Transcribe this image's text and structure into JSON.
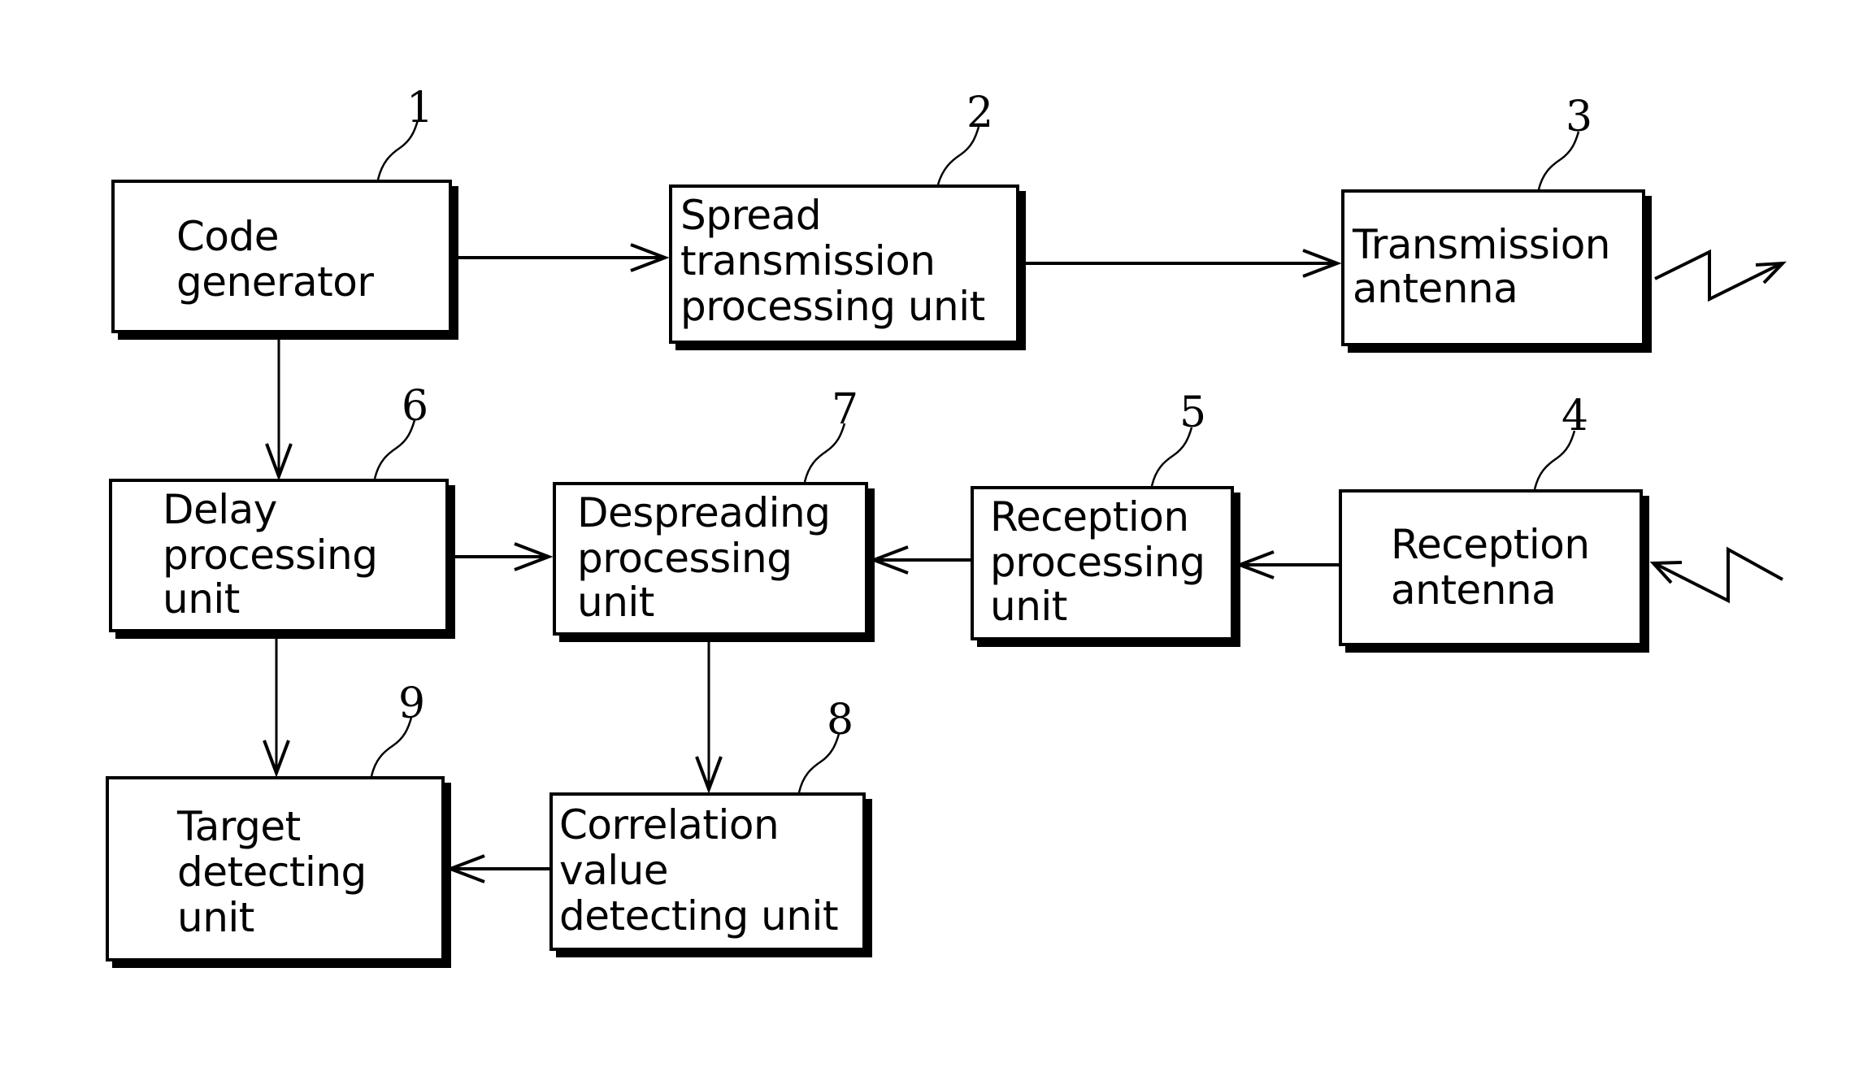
{
  "diagram": {
    "type": "block-diagram",
    "blocks": [
      {
        "id": "1",
        "ref": "1",
        "lines": [
          "Code",
          "generator"
        ]
      },
      {
        "id": "2",
        "ref": "2",
        "lines": [
          "Spread",
          "transmission",
          "processing unit"
        ]
      },
      {
        "id": "3",
        "ref": "3",
        "lines": [
          "Transmission",
          "antenna"
        ]
      },
      {
        "id": "4",
        "ref": "4",
        "lines": [
          "Reception",
          "antenna"
        ]
      },
      {
        "id": "5",
        "ref": "5",
        "lines": [
          "Reception",
          "processing",
          "unit"
        ]
      },
      {
        "id": "6",
        "ref": "6",
        "lines": [
          "Delay",
          "processing",
          "unit"
        ]
      },
      {
        "id": "7",
        "ref": "7",
        "lines": [
          "Despreading",
          "processing",
          "unit"
        ]
      },
      {
        "id": "8",
        "ref": "8",
        "lines": [
          "Correlation",
          "value",
          "detecting unit"
        ]
      },
      {
        "id": "9",
        "ref": "9",
        "lines": [
          "Target",
          "detecting",
          "unit"
        ]
      }
    ],
    "edges": [
      {
        "from": "1",
        "to": "2"
      },
      {
        "from": "2",
        "to": "3"
      },
      {
        "from": "1",
        "to": "6"
      },
      {
        "from": "6",
        "to": "7"
      },
      {
        "from": "5",
        "to": "7"
      },
      {
        "from": "4",
        "to": "5"
      },
      {
        "from": "7",
        "to": "8"
      },
      {
        "from": "6",
        "to": "9"
      },
      {
        "from": "8",
        "to": "9"
      }
    ],
    "signals": [
      {
        "name": "transmitted-wave",
        "direction": "outgoing",
        "attached_to": "3"
      },
      {
        "name": "received-wave",
        "direction": "incoming",
        "attached_to": "4"
      }
    ]
  }
}
